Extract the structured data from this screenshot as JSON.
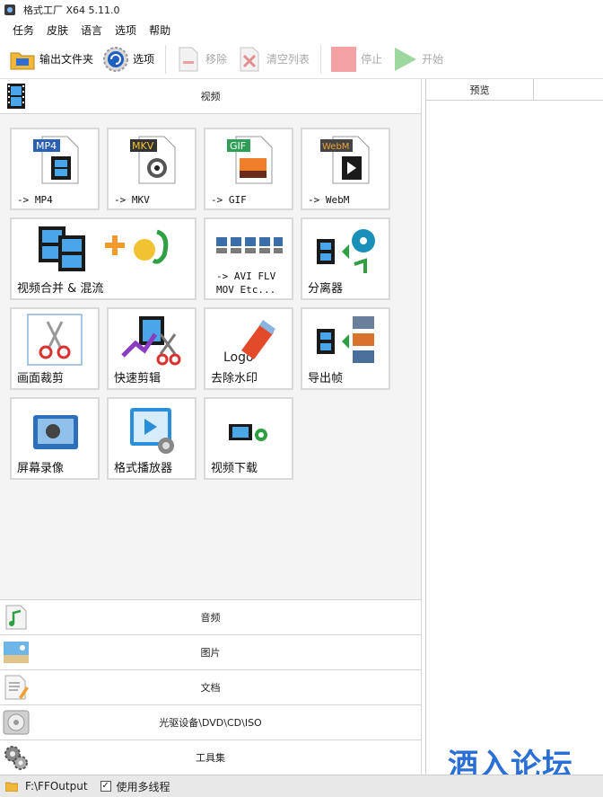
{
  "window": {
    "title": "格式工厂 X64 5.11.0"
  },
  "menu": [
    "任务",
    "皮肤",
    "语言",
    "选项",
    "帮助"
  ],
  "toolbar": {
    "output_folder": "输出文件夹",
    "options": "选项",
    "remove": "移除",
    "clear_list": "清空列表",
    "stop": "停止",
    "start": "开始"
  },
  "categories": {
    "video": "视频",
    "audio": "音频",
    "image": "图片",
    "document": "文档",
    "disc": "光驱设备\\DVD\\CD\\ISO",
    "toolbox": "工具集"
  },
  "video_tiles": [
    {
      "label": "-> MP4",
      "badge": "MP4",
      "badge_color": "#2b5fb4"
    },
    {
      "label": "-> MKV",
      "badge": "MKV",
      "badge_color": "#333333"
    },
    {
      "label": "-> GIF",
      "badge": "GIF",
      "badge_color": "#2e9e58"
    },
    {
      "label": "-> WebM",
      "badge": "WebM",
      "badge_color": "#444444"
    },
    {
      "label": "视频合并 & 混流"
    },
    {
      "label_line1": "-> AVI FLV",
      "label_line2": "MOV Etc..."
    },
    {
      "label": "分离器"
    },
    {
      "label": "画面裁剪"
    },
    {
      "label": "快速剪辑"
    },
    {
      "label": "去除水印",
      "art_text": "Logo"
    },
    {
      "label": "导出帧"
    },
    {
      "label": "屏幕录像"
    },
    {
      "label": "格式播放器"
    },
    {
      "label": "视频下载"
    }
  ],
  "preview": {
    "header": "预览"
  },
  "watermark": "酒入论坛",
  "status": {
    "path": "F:\\FFOutput",
    "multithread_label": "使用多线程",
    "multithread_checked": true
  }
}
